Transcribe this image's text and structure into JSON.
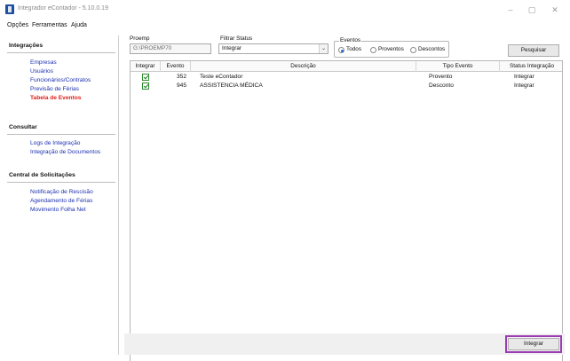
{
  "window": {
    "title": "Integrador eContador - 5.10.0.19",
    "minimize": "–",
    "maximize": "▢",
    "close": "✕"
  },
  "menu": [
    "Opções",
    "Ferramentas",
    "Ajuda"
  ],
  "sidebar": {
    "sections": [
      {
        "title": "Integrações",
        "items": [
          {
            "label": "Empresas",
            "active": false
          },
          {
            "label": "Usuários",
            "active": false
          },
          {
            "label": "Funcionários/Contratos",
            "active": false
          },
          {
            "label": "Previsão de Férias",
            "active": false
          },
          {
            "label": "Tabela de Eventos",
            "active": true
          }
        ]
      },
      {
        "title": "Consultar",
        "items": [
          {
            "label": "Logs de Integração",
            "active": false
          },
          {
            "label": "Integração de Documentos",
            "active": false
          }
        ]
      },
      {
        "title": "Central de Solicitações",
        "items": [
          {
            "label": "Notificação de Rescisão",
            "active": false
          },
          {
            "label": "Agendamento de Férias",
            "active": false
          },
          {
            "label": "Movimento Folha Net",
            "active": false
          }
        ]
      }
    ]
  },
  "filters": {
    "proemp_label": "Proemp",
    "proemp_value": "G:\\PROEMP70",
    "status_label": "Filtrar Status",
    "status_value": "Integrar",
    "eventos_label": "Eventos",
    "eventos_options": [
      "Todos",
      "Proventos",
      "Descontos"
    ],
    "eventos_selected": "Todos",
    "search_button": "Pesquisar"
  },
  "table": {
    "columns": [
      "Integrar",
      "Evento",
      "Descrição",
      "Tipo Evento",
      "Status Integração"
    ],
    "rows": [
      {
        "integrar": true,
        "evento": "352",
        "descricao": "Teste eContador",
        "tipo": "Provento",
        "status": "Integrar"
      },
      {
        "integrar": true,
        "evento": "945",
        "descricao": "ASSISTENCIA MÉDICA",
        "tipo": "Desconto",
        "status": "Integrar"
      }
    ]
  },
  "footer": {
    "integrar_button": "Integrar"
  },
  "colors": {
    "link": "#1a2fb0",
    "active_link": "#e0201a",
    "highlight": "#9b3bb4"
  }
}
